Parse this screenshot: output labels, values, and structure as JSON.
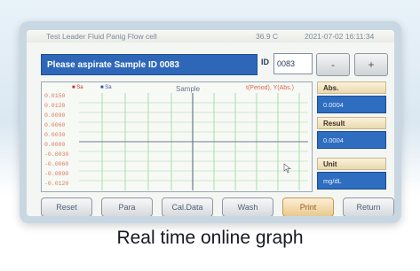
{
  "topbar": {
    "title": "Test Leader Fluid Panig Flow cell",
    "temperature": "36.9 C",
    "datetime": "2021-07-02 16:11:34"
  },
  "prompt": {
    "message": "Please aspirate Sample ID 0083"
  },
  "sample_id": {
    "label": "ID",
    "value": "0083"
  },
  "buttons": {
    "decrement": "-",
    "increment": "+"
  },
  "graph": {
    "legend": [
      "Sa",
      "Sa"
    ],
    "title": "Sample",
    "units": "t(Period), Y(Abs.)",
    "yticks": [
      "0.0150",
      "0.0120",
      "0.0090",
      "0.0060",
      "0.0030",
      "0.0000",
      "-0.0030",
      "-0.0060",
      "-0.0090",
      "-0.0120"
    ]
  },
  "side": {
    "abs_label": "Abs.",
    "abs_value": "0.0004",
    "result_label": "Result",
    "result_value": "0.0004",
    "unit_label": "Unit",
    "unit_value": "mg/dL"
  },
  "bottom": {
    "labels": [
      "Reset",
      "Para",
      "Cal.Data",
      "Wash",
      "Print",
      "Return"
    ]
  },
  "caption": "Real time online graph",
  "colors": {
    "accent_blue": "#2f67b8",
    "panel_gold": "#e9d8ae",
    "print_orange": "#e9c98e"
  }
}
